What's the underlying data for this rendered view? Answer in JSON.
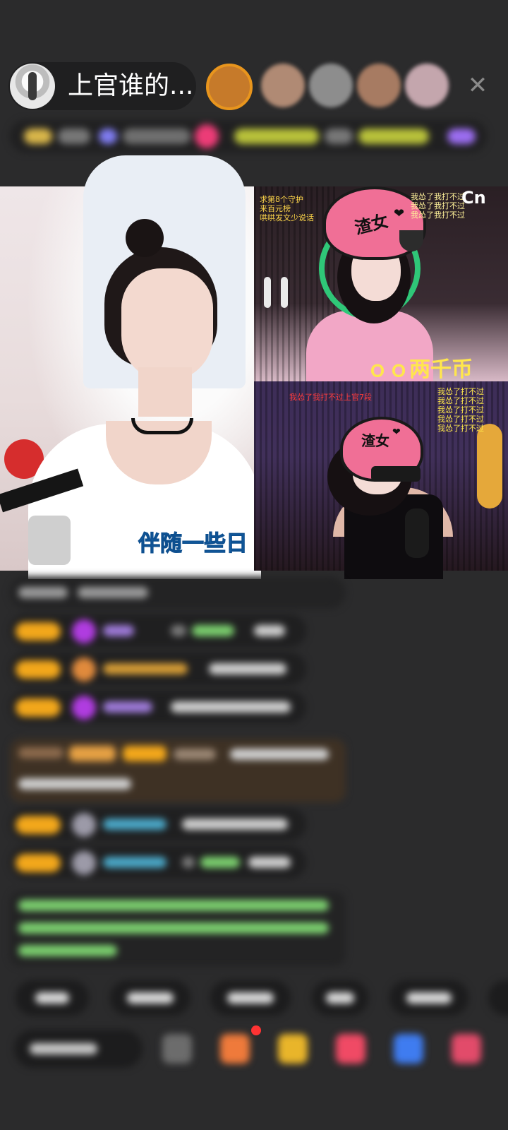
{
  "header": {
    "host_name": "上官谁的...",
    "close_icon": "close-icon",
    "viewer_avatars": [
      {
        "color": "#c67a2a"
      },
      {
        "color": "#b08a74"
      },
      {
        "color": "#8d8d8d"
      },
      {
        "color": "#a77b62"
      },
      {
        "color": "#c4a6ad"
      }
    ]
  },
  "videos": {
    "main_caption": "伴随一些日",
    "top_right_caption": "ｏｏ两千币",
    "top_right_badge": "Cn",
    "helmet_label": "渣女",
    "top_right_lines": "求第8个守护\n来百元榜\n哄哄发文少说话",
    "top_right_red": "我怂了我打不过\n我怂了我打不过\n我怂了我打不过",
    "bottom_right_lines": "我怂了打不过\n我怂了打不过\n我怂了打不过\n我怂了打不过\n我怂了打不过",
    "bottom_right_red": "我怂了我打不过上官7段"
  },
  "colors": {
    "level_badge": "#f2a71b",
    "nick_purple": "#9e7ad9",
    "nick_green": "#7bcf6e",
    "nick_cyan": "#4aa7c7",
    "nick_orange": "#d49b35",
    "highlight_bg": "#3e3124",
    "system_green": "#7bcf6e"
  }
}
